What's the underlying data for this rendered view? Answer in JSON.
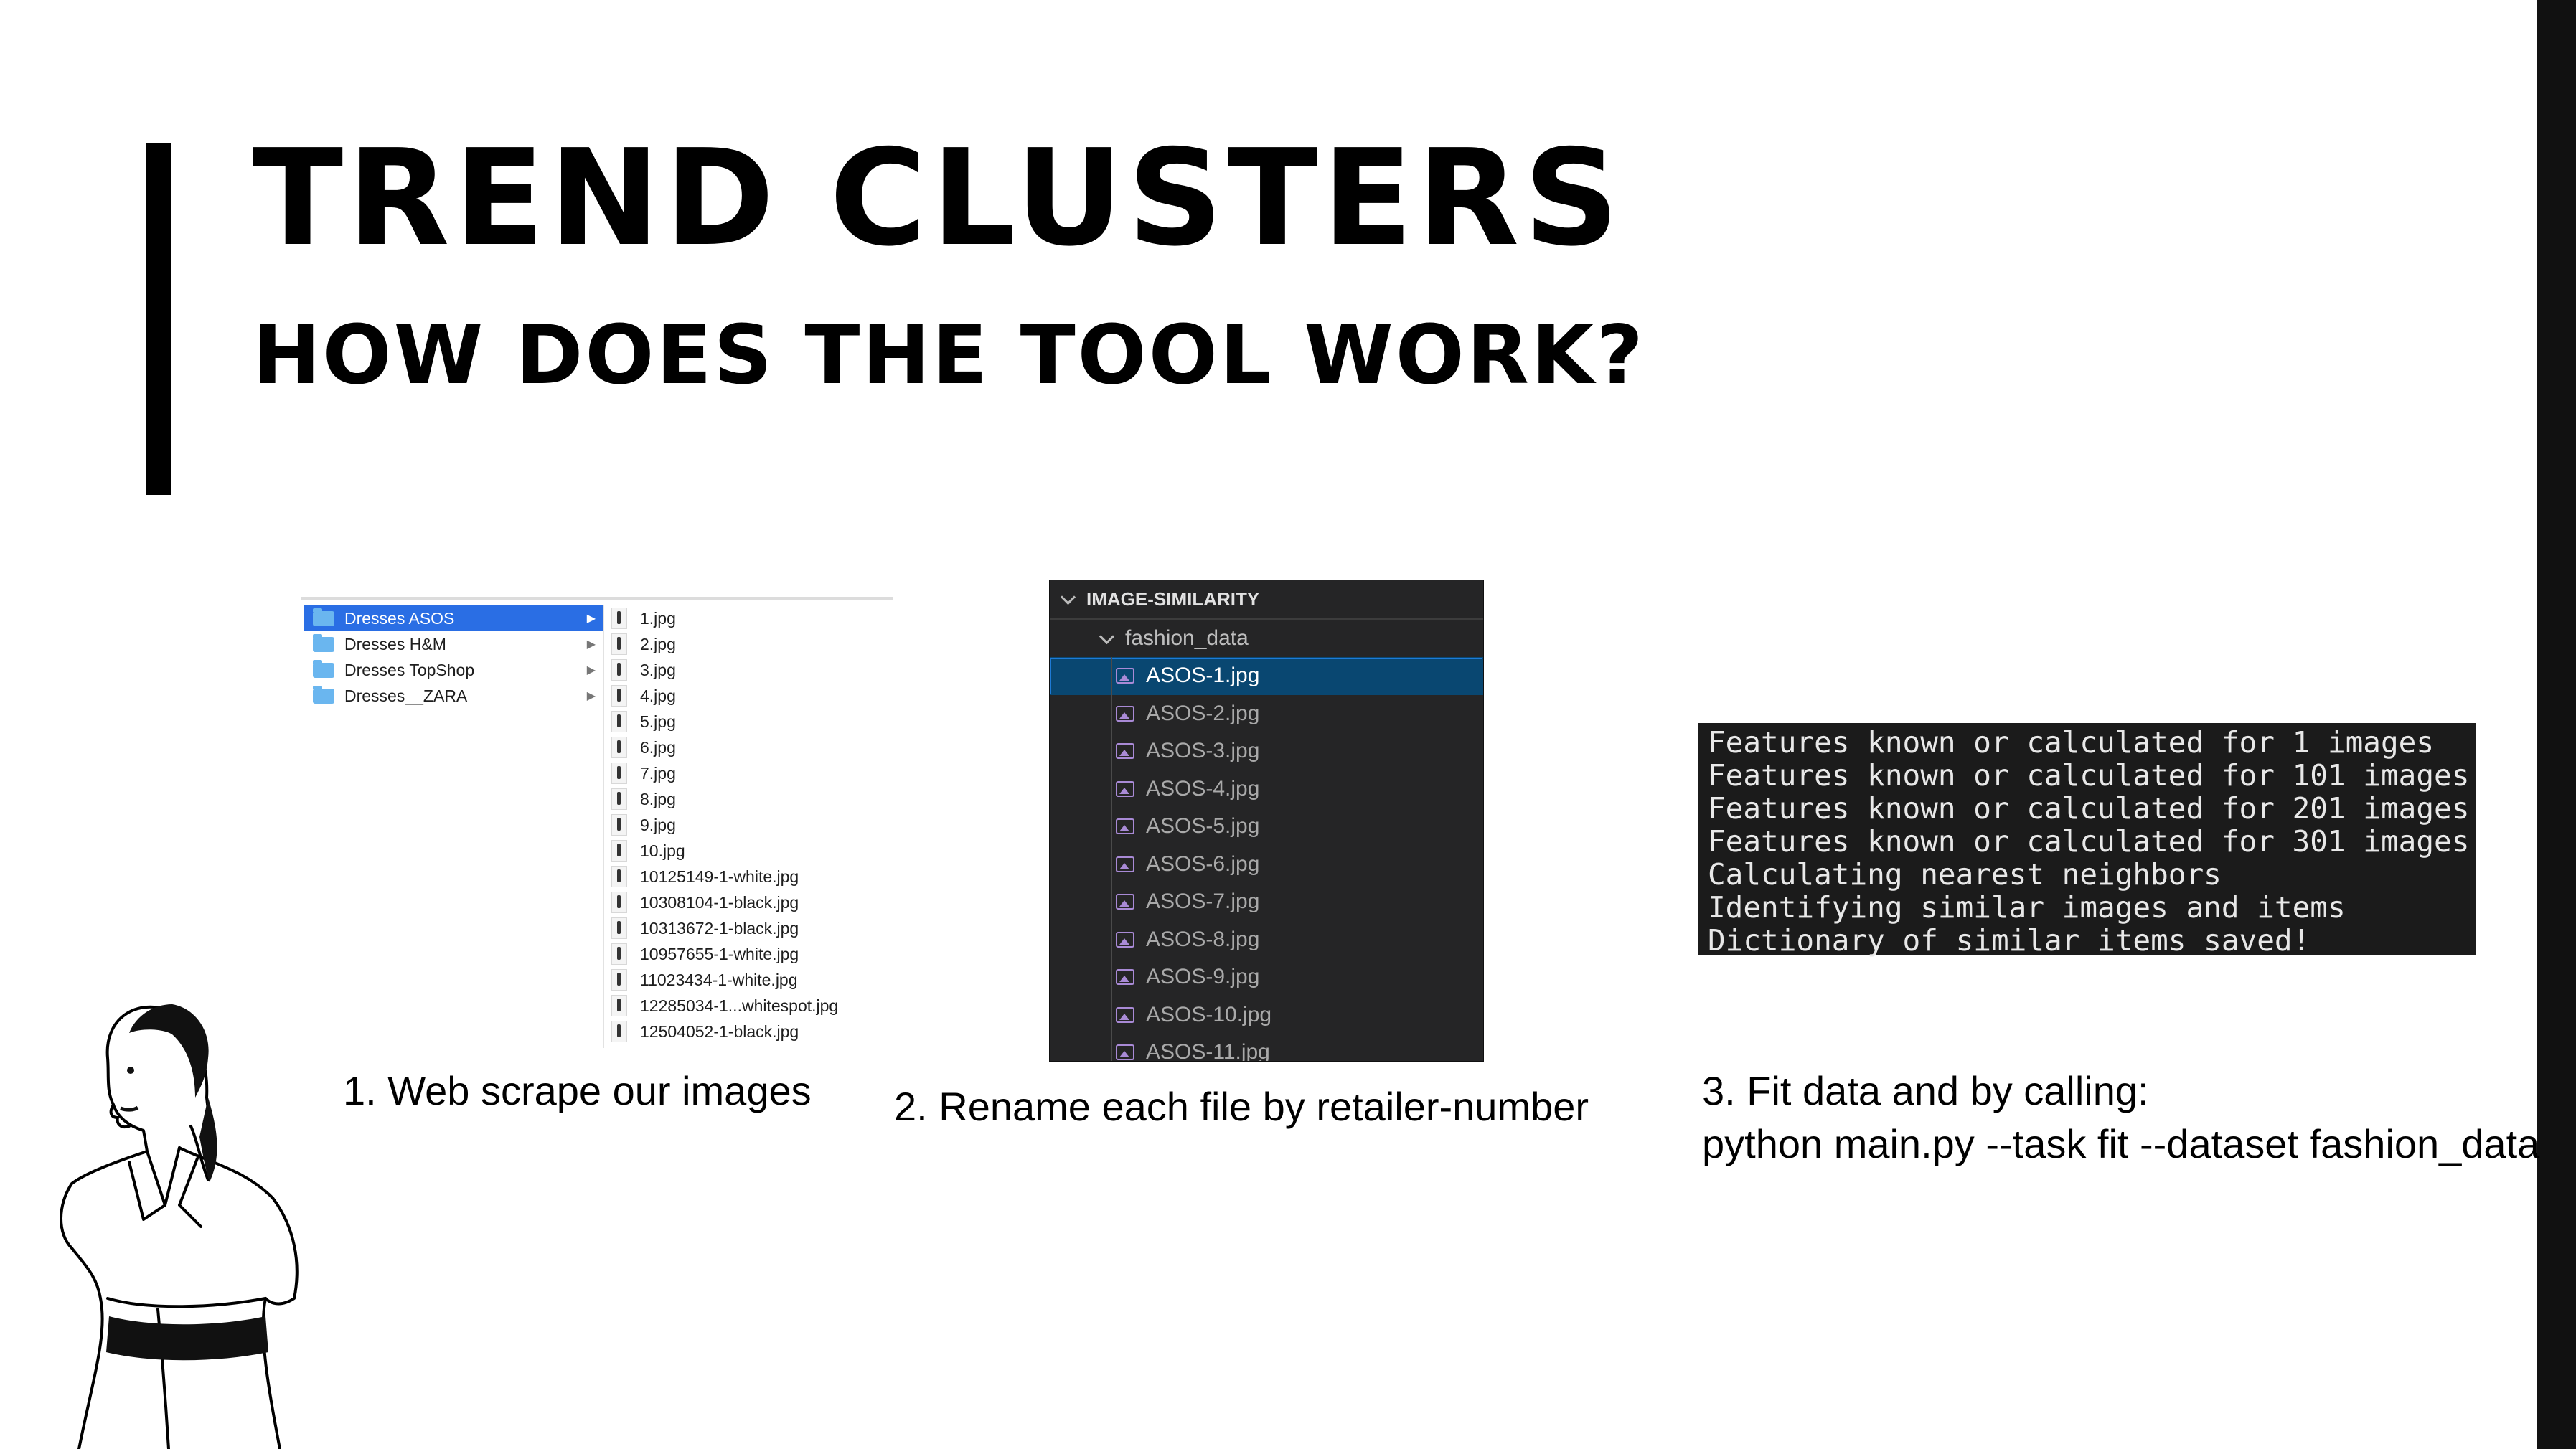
{
  "slide": {
    "title": "TREND CLUSTERS",
    "subtitle": "HOW DOES THE TOOL WORK?"
  },
  "finder": {
    "folders": [
      {
        "label": "Dresses ASOS",
        "selected": true
      },
      {
        "label": "Dresses H&M",
        "selected": false
      },
      {
        "label": "Dresses TopShop",
        "selected": false
      },
      {
        "label": "Dresses__ZARA",
        "selected": false
      }
    ],
    "files": [
      "1.jpg",
      "2.jpg",
      "3.jpg",
      "4.jpg",
      "5.jpg",
      "6.jpg",
      "7.jpg",
      "8.jpg",
      "9.jpg",
      "10.jpg",
      "10125149-1-white.jpg",
      "10308104-1-black.jpg",
      "10313672-1-black.jpg",
      "10957655-1-white.jpg",
      "11023434-1-white.jpg",
      "12285034-1...whitespot.jpg",
      "12504052-1-black.jpg"
    ]
  },
  "vscode": {
    "header": "IMAGE-SIMILARITY",
    "folder": "fashion_data",
    "files": [
      "ASOS-1.jpg",
      "ASOS-2.jpg",
      "ASOS-3.jpg",
      "ASOS-4.jpg",
      "ASOS-5.jpg",
      "ASOS-6.jpg",
      "ASOS-7.jpg",
      "ASOS-8.jpg",
      "ASOS-9.jpg",
      "ASOS-10.jpg",
      "ASOS-11.jpg"
    ],
    "selected_index": 0
  },
  "terminal": {
    "lines": [
      "Features known or calculated for 1 images",
      "Features known or calculated for 101 images",
      "Features known or calculated for 201 images",
      "Features known or calculated for 301 images",
      "Calculating nearest neighbors",
      "Identifying similar images and items",
      "Dictionary of similar items saved!"
    ]
  },
  "captions": {
    "step1": "1.  Web scrape our images",
    "step2": "2. Rename each file by retailer-number",
    "step3_line1": "3. Fit data and  by calling:",
    "step3_line2": "python main.py --task fit --dataset fashion_data"
  },
  "icons": {
    "folder": "folder-icon",
    "image_file": "image-file-icon",
    "chevron": "chevron-down-icon",
    "disclosure": "disclosure-arrow-icon"
  },
  "colors": {
    "finder_selection": "#2a6ee4",
    "vscode_background": "#252526",
    "vscode_selection": "#094771",
    "terminal_background": "#1b1b1b",
    "accent_bar": "#000000"
  }
}
